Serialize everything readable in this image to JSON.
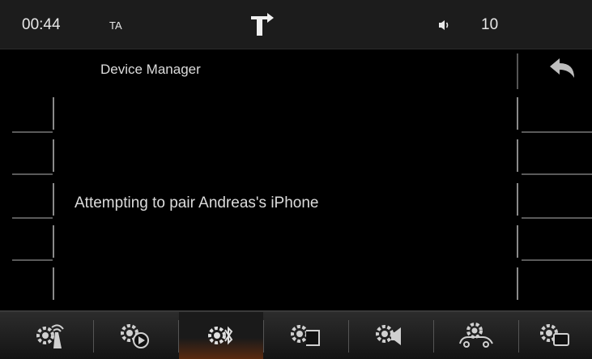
{
  "status": {
    "time": "00:44",
    "ta": "TA",
    "volume": "10",
    "nav_icon": "turn-right-arrow-icon",
    "volume_icon": "speaker-icon"
  },
  "header": {
    "title": "Device Manager",
    "back_icon": "back-arrow-icon"
  },
  "main": {
    "message": "Attempting to pair Andreas's iPhone"
  },
  "bottom_tabs": [
    {
      "icon": "radio-antenna-settings-icon"
    },
    {
      "icon": "media-play-settings-icon"
    },
    {
      "icon": "bluetooth-settings-icon",
      "active": true
    },
    {
      "icon": "display-settings-icon"
    },
    {
      "icon": "audio-settings-icon"
    },
    {
      "icon": "vehicle-settings-icon"
    },
    {
      "icon": "screen-settings-icon"
    }
  ],
  "colors": {
    "active_tab": "#5a2a10",
    "background": "#000000"
  }
}
